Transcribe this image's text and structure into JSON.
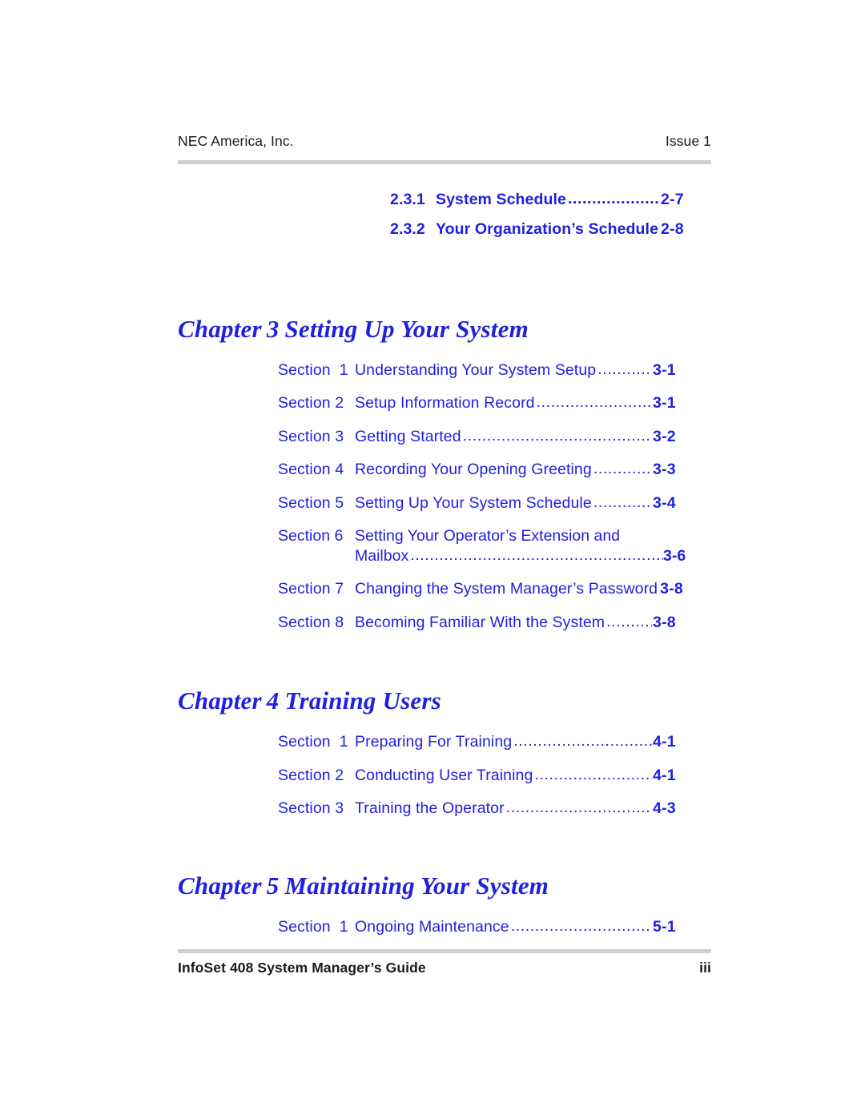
{
  "header": {
    "left": "NEC America, Inc.",
    "right": "Issue 1"
  },
  "footer": {
    "left": "InfoSet 408 System Manager’s Guide",
    "right": "iii"
  },
  "leader_dots": "....................................................................................................",
  "continued_subentries": [
    {
      "label": "2.3.1",
      "title": "System Schedule",
      "page": "2-7"
    },
    {
      "label": "2.3.2",
      "title": "Your Organization’s Schedule",
      "page": "2-8"
    }
  ],
  "chapters": [
    {
      "word": "Chapter",
      "number": "3",
      "title": "Setting Up Your System",
      "entries": [
        {
          "label": "Section  1",
          "title": "Understanding Your System Setup",
          "page": "3-1"
        },
        {
          "label": "Section 2",
          "title": "Setup Information Record",
          "page": "3-1"
        },
        {
          "label": "Section 3",
          "title": "Getting Started",
          "page": "3-2"
        },
        {
          "label": "Section 4",
          "title": "Recording Your Opening Greeting",
          "page": "3-3"
        },
        {
          "label": "Section 5",
          "title": "Setting Up Your System Schedule",
          "page": "3-4"
        },
        {
          "label": "Section 6",
          "title": "Setting Your Operator’s Extension and",
          "title2": "Mailbox",
          "page": "3-6"
        },
        {
          "label": "Section 7",
          "title": "Changing the System Manager’s Password",
          "page": "3-8"
        },
        {
          "label": "Section 8",
          "title": "Becoming Familiar With the System",
          "page": "3-8"
        }
      ]
    },
    {
      "word": "Chapter",
      "number": "4",
      "title": "Training Users",
      "entries": [
        {
          "label": "Section  1",
          "title": "Preparing For Training",
          "page": "4-1"
        },
        {
          "label": "Section 2",
          "title": "Conducting User Training",
          "page": "4-1"
        },
        {
          "label": "Section 3",
          "title": "Training the Operator",
          "page": "4-3"
        }
      ]
    },
    {
      "word": "Chapter",
      "number": "5",
      "title": "Maintaining Your System",
      "entries": [
        {
          "label": "Section  1",
          "title": "Ongoing Maintenance",
          "page": "5-1"
        }
      ]
    }
  ],
  "colors": {
    "link_blue": "#2020e0",
    "rule_gray": "#cfcfcf",
    "body_black": "#1a1a1a"
  }
}
